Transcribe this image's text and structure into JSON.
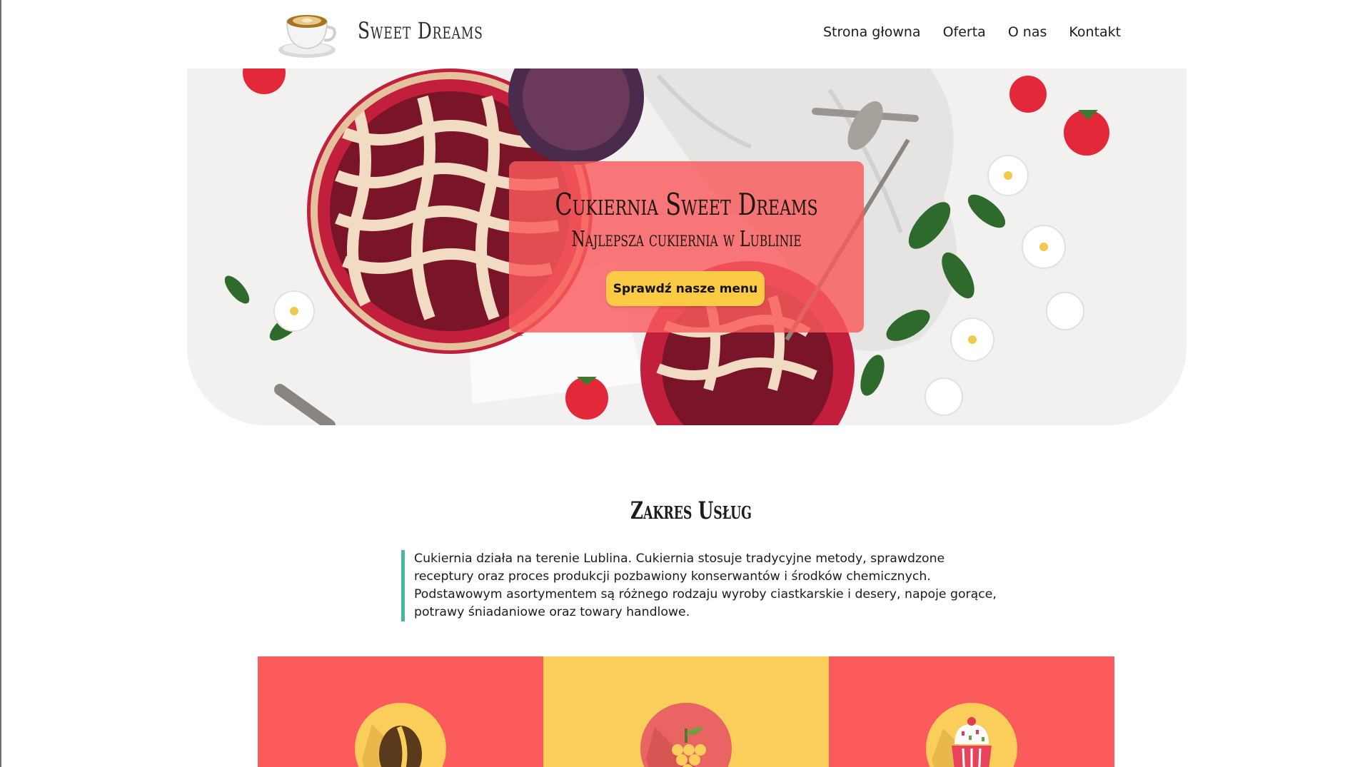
{
  "header": {
    "brand": "Sweet Dreams",
    "nav": [
      "Strona głowna",
      "Oferta",
      "O nas",
      "Kontakt"
    ]
  },
  "hero": {
    "title": "Cukiernia Sweet Dreams",
    "subtitle": "Najlepsza cukiernia w Lublinie",
    "button_label": "Sprawdź nasze menu"
  },
  "services": {
    "title": "Zakres Usług",
    "description": "Cukiernia działa na terenie Lublina. Cukiernia stosuje tradycyjne metody, sprawdzone receptury oraz proces produkcji pozbawiony konserwantów i środków chemicznych. Podstawowym asortymentem są różnego rodzaju wyroby ciastkarskie i desery, napoje gorące, potrawy śniadaniowe oraz towary handlowe."
  },
  "tiles": [
    {
      "icon": "coffee-bean-icon",
      "color": "#fb5b5a"
    },
    {
      "icon": "grapes-icon",
      "color": "#fbcd5a"
    },
    {
      "icon": "cupcake-icon",
      "color": "#fb5b5a"
    }
  ],
  "colors": {
    "accent_red": "#fb5b5a",
    "accent_yellow": "#fbcb45",
    "quote_border": "#46b7a3"
  }
}
